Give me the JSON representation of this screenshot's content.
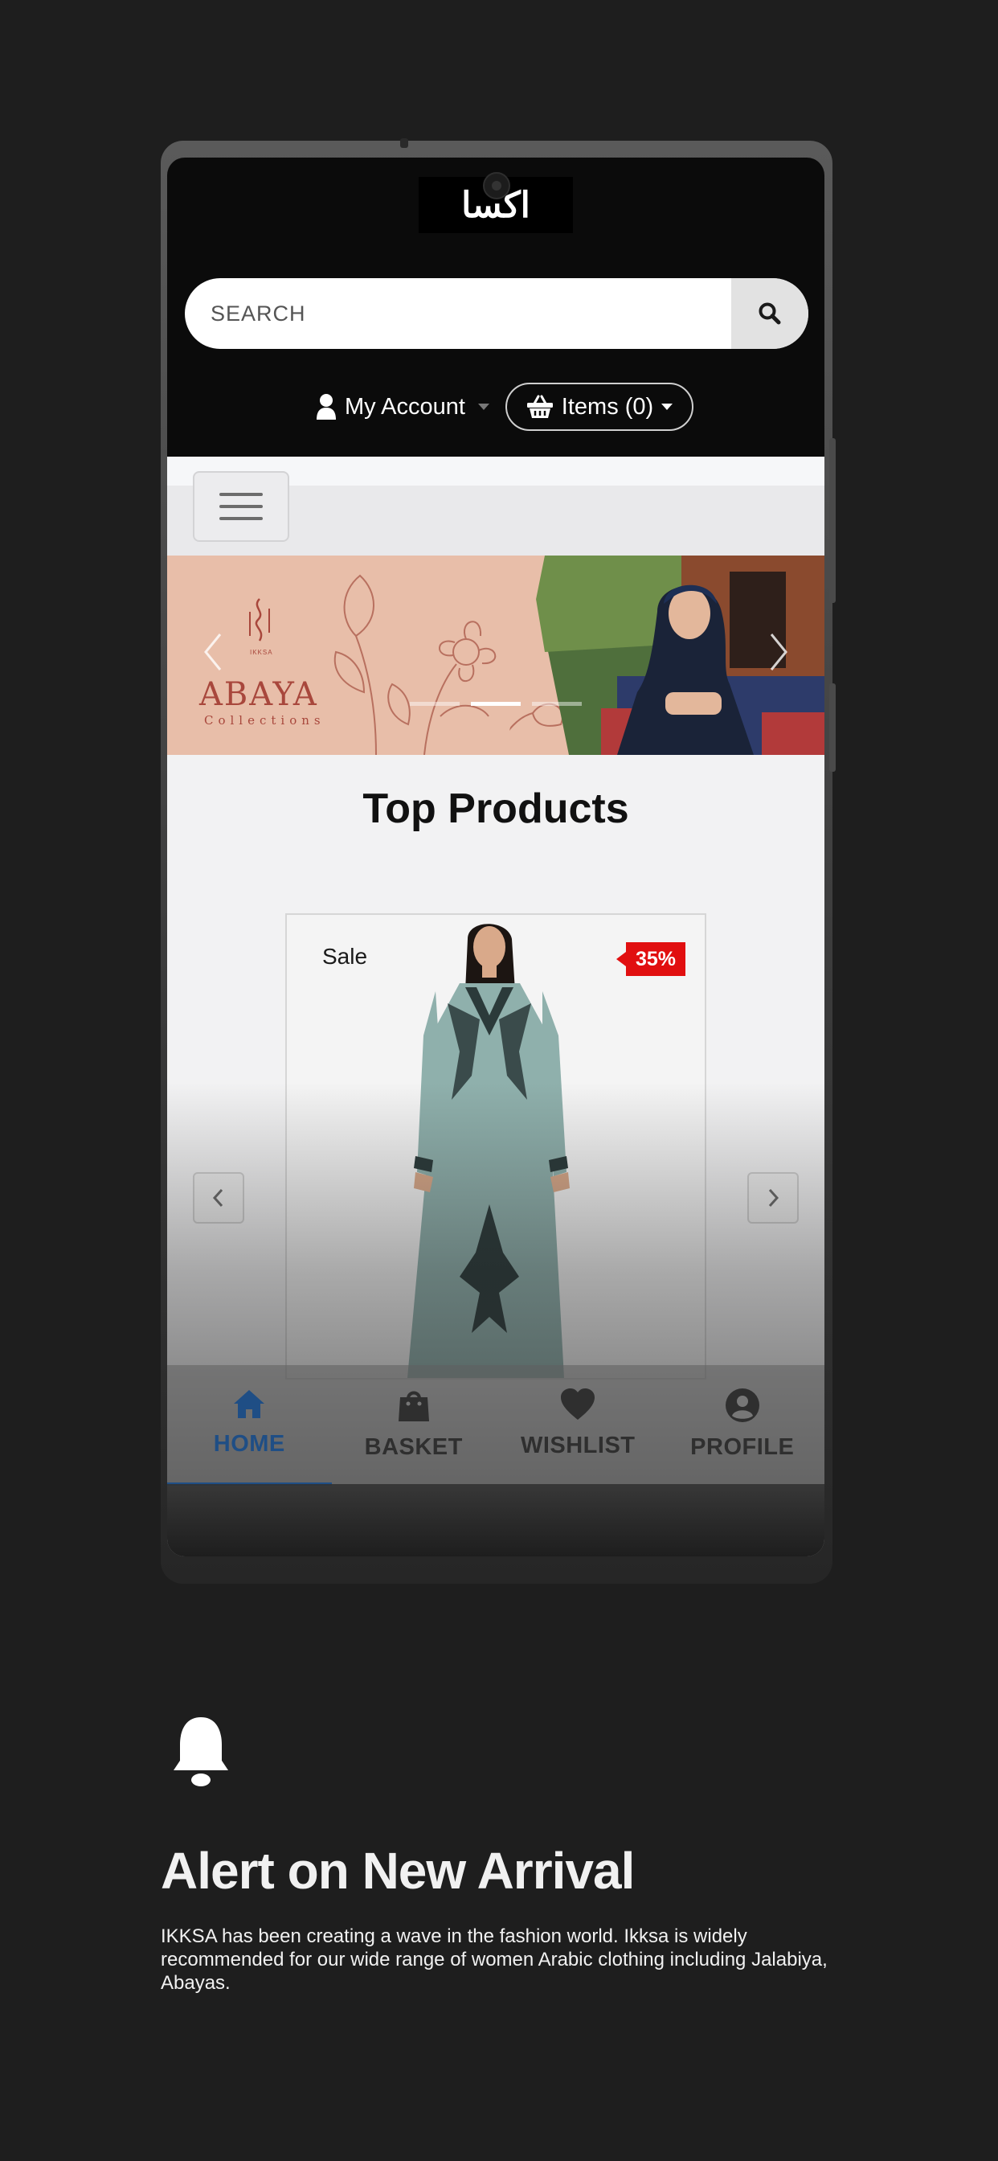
{
  "header": {
    "logo_text": "اكسا",
    "search": {
      "placeholder": "SEARCH",
      "value": ""
    },
    "account_label": "My Account",
    "cart_label": "Items (0)"
  },
  "banner": {
    "brand_small": "IKKSA",
    "brand": "ABAYA",
    "subtitle": "Collections",
    "slide_count": 3,
    "active_slide": 2
  },
  "section": {
    "title": "Top Products"
  },
  "product": {
    "sale_label": "Sale",
    "discount": "35%"
  },
  "tabbar": {
    "items": [
      {
        "label": "HOME",
        "icon": "home-icon",
        "active": true
      },
      {
        "label": "BASKET",
        "icon": "shopping-bag-icon",
        "active": false
      },
      {
        "label": "WISHLIST",
        "icon": "heart-icon",
        "active": false
      },
      {
        "label": "PROFILE",
        "icon": "user-circle-icon",
        "active": false
      }
    ]
  },
  "feature": {
    "icon": "bell-icon",
    "title": "Alert on New Arrival",
    "description": "IKKSA has been creating a wave in the fashion world. Ikksa is widely recommended for our wide range of women Arabic clothing including Jalabiya, Abayas."
  },
  "colors": {
    "background": "#1e1e1e",
    "accent_blue": "#1f4e85",
    "sale_red": "#e10f10",
    "banner_peach": "#e8bea9",
    "brand_rust": "#a8473c"
  }
}
